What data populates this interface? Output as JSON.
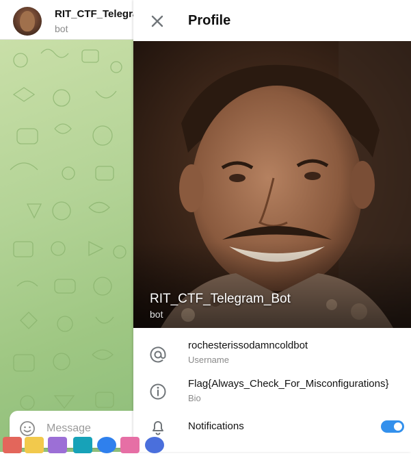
{
  "chat": {
    "title": "RIT_CTF_Telegra",
    "subtitle": "bot",
    "composer_placeholder": "Message",
    "background_color": "#b3d396"
  },
  "profile": {
    "header_title": "Profile",
    "name": "RIT_CTF_Telegram_Bot",
    "subtitle": "bot",
    "username": {
      "value": "rochesterissodamncoldbot",
      "label": "Username"
    },
    "bio": {
      "value": "Flag{Always_Check_For_Misconfigurations}",
      "label": "Bio"
    },
    "notifications": {
      "label": "Notifications",
      "enabled": true
    },
    "accent_color": "#3390ec"
  },
  "taskbar": {
    "icons": [
      "files-icon",
      "play-store-icon",
      "terminal-icon",
      "chrome-icon",
      "photos-icon",
      "browser-icon"
    ]
  }
}
